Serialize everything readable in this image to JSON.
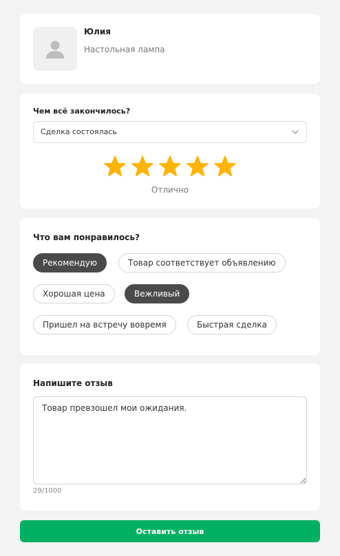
{
  "seller": {
    "name": "Юлия",
    "item": "Настольная лампа",
    "avatar_icon": "user-silhouette-icon"
  },
  "deal": {
    "question": "Чем всё закончилось?",
    "selected": "Сделка состоялась",
    "dropdown_icon": "chevron-down-icon"
  },
  "rating": {
    "value": 5,
    "max": 5,
    "label": "Отлично",
    "star_color": "#ffb400"
  },
  "liked": {
    "title": "Что вам понравилось?",
    "chips": [
      {
        "label": "Рекомендую",
        "selected": true
      },
      {
        "label": "Товар соответствует объявлению",
        "selected": false
      },
      {
        "label": "Хорошая цена",
        "selected": false
      },
      {
        "label": "Вежливый",
        "selected": true
      },
      {
        "label": "Пришел на встречу вовремя",
        "selected": false
      },
      {
        "label": "Быстрая сделка",
        "selected": false
      }
    ]
  },
  "review": {
    "title": "Напишите отзыв",
    "text": "Товар превзошел мои ожидания.",
    "counter": "29/1000"
  },
  "submit": {
    "label": "Оставить отзыв",
    "color": "#00b061"
  }
}
